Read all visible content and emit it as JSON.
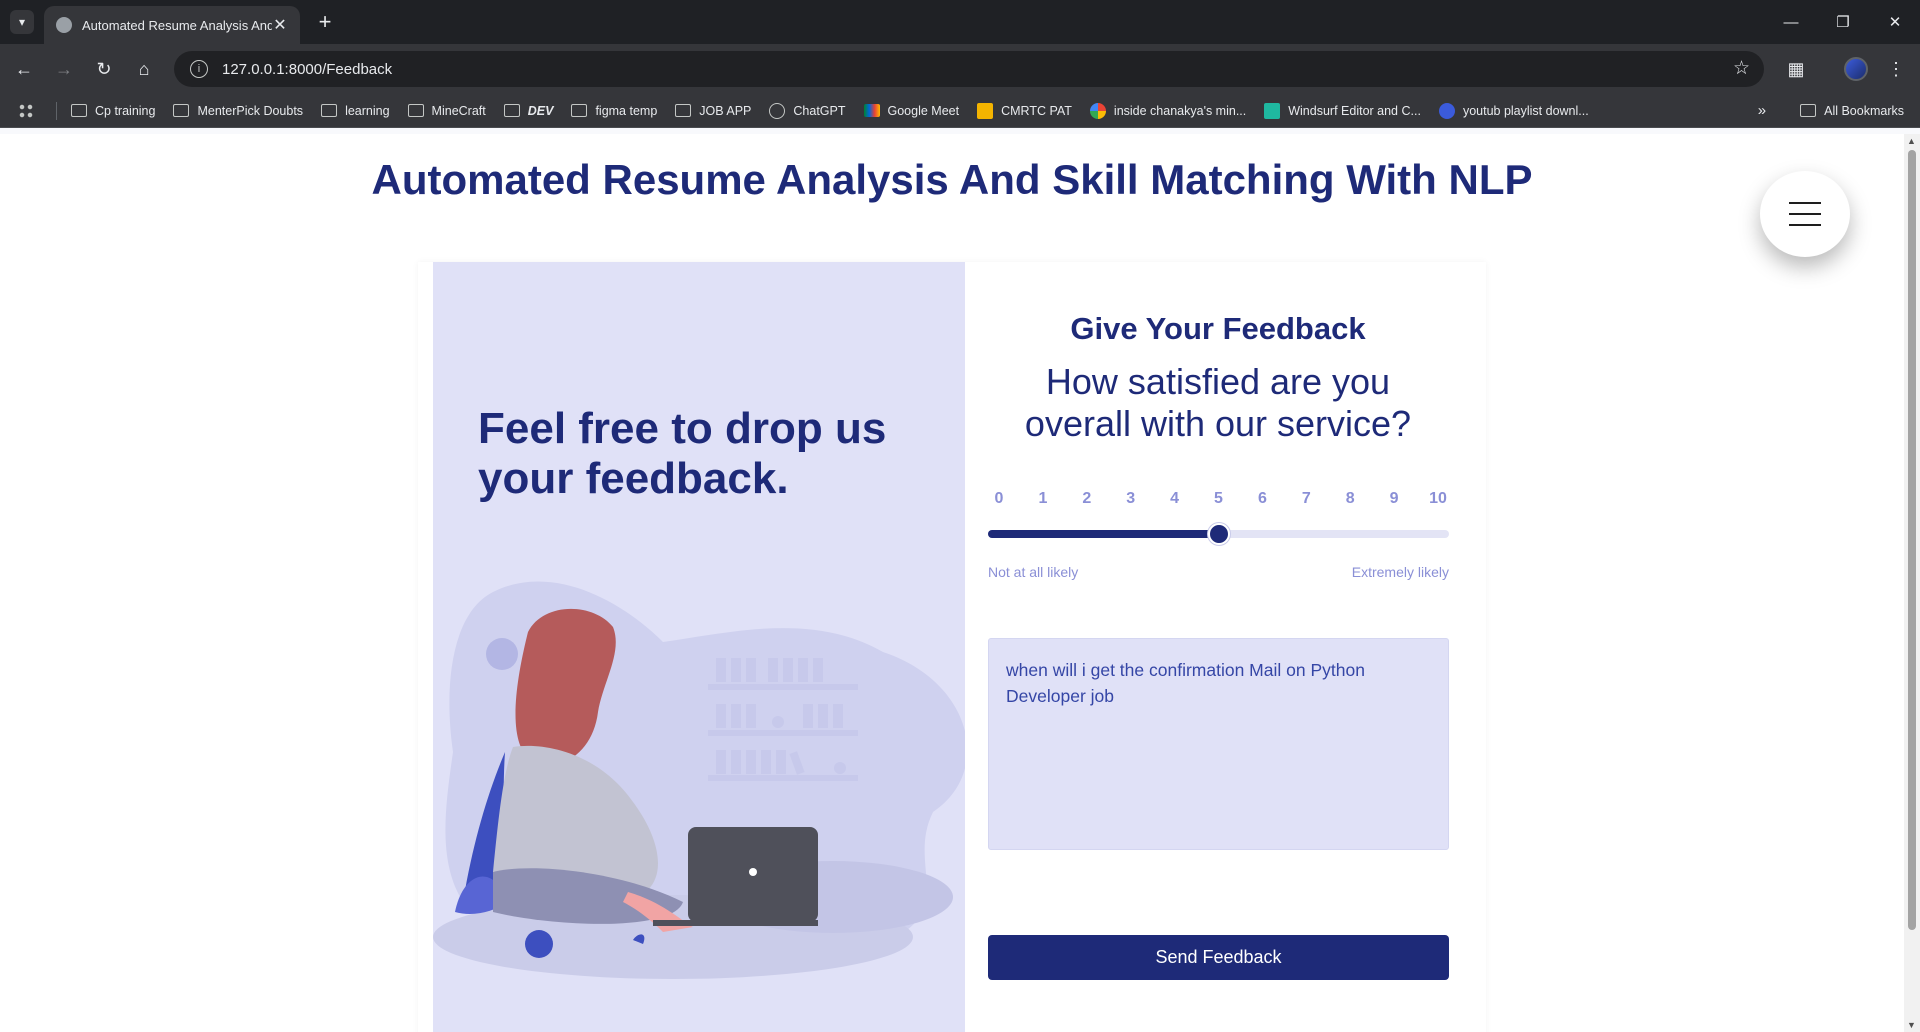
{
  "browser": {
    "tab_title": "Automated Resume Analysis And Skill Matching With NLP",
    "url": "127.0.0.1:8000/Feedback",
    "bookmarks": [
      {
        "label": "Cp training",
        "icon": "folder-icon"
      },
      {
        "label": "MenterPick Doubts",
        "icon": "folder-icon"
      },
      {
        "label": "learning",
        "icon": "folder-icon"
      },
      {
        "label": "MineCraft",
        "icon": "folder-icon"
      },
      {
        "label": "DEV",
        "icon": "folder-icon"
      },
      {
        "label": "figma temp",
        "icon": "folder-icon"
      },
      {
        "label": "JOB APP",
        "icon": "folder-icon"
      },
      {
        "label": "ChatGPT",
        "icon": "chatgpt-icon"
      },
      {
        "label": "Google Meet",
        "icon": "google-meet-icon"
      },
      {
        "label": "CMRTC PAT",
        "icon": "cmrtc-icon"
      },
      {
        "label": "inside chanakya's min...",
        "icon": "google-icon"
      },
      {
        "label": "Windsurf Editor and C...",
        "icon": "windsurf-icon"
      },
      {
        "label": "youtub playlist downl...",
        "icon": "youtube-dl-icon"
      }
    ],
    "all_bookmarks": "All Bookmarks"
  },
  "page": {
    "title": "Automated Resume Analysis And Skill Matching With NLP",
    "left_heading": "Feel free to drop us your feedback.",
    "form_title": "Give Your Feedback",
    "question": "How satisfied are you overall with our service?",
    "scale": {
      "ticks": [
        "0",
        "1",
        "2",
        "3",
        "4",
        "5",
        "6",
        "7",
        "8",
        "9",
        "10"
      ],
      "min": 0,
      "max": 10,
      "value": 5,
      "min_label": "Not at all likely",
      "max_label": "Extremely likely"
    },
    "feedback_text": "when will i get the confirmation Mail on Python Developer job",
    "submit_label": "Send Feedback"
  },
  "colors": {
    "primary": "#1e2a78",
    "panel": "#e0e1f7",
    "muted": "#8a8fd6"
  }
}
